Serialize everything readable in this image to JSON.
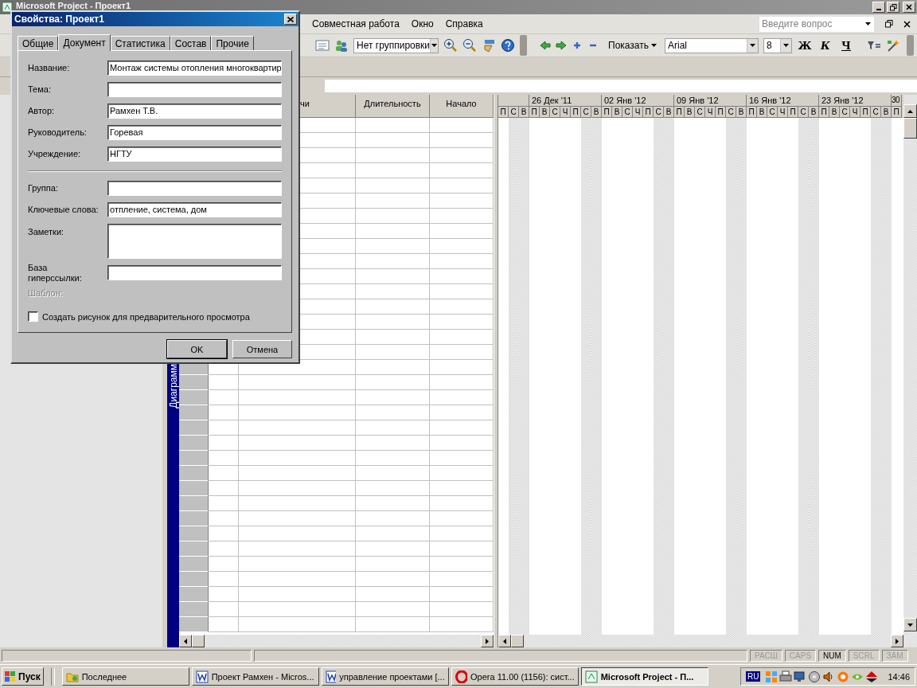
{
  "window": {
    "title": "Microsoft Project - Проект1"
  },
  "menu": [
    {
      "label": "Совместная работа"
    },
    {
      "label": "Окно"
    },
    {
      "label": "Справка"
    }
  ],
  "help_search": {
    "placeholder": "Введите вопрос"
  },
  "toolbar": {
    "grouping": "Нет группировки",
    "show": "Показать",
    "font": "Arial",
    "font_size": "8",
    "format_buttons": [
      {
        "label": "Ж",
        "kind": "bold"
      },
      {
        "label": "К",
        "kind": "italic"
      },
      {
        "label": "Ч",
        "kind": "underline"
      }
    ]
  },
  "side_label": "Диаграмм",
  "table": {
    "columns": [
      "чи",
      "Длительность",
      "Начало"
    ]
  },
  "gantt": {
    "weeks": [
      {
        "days": [
          {
            "label": "П",
            "weekend": false
          },
          {
            "label": "С",
            "weekend": true
          },
          {
            "label": "В",
            "weekend": true
          }
        ]
      },
      {
        "label": "26 Дек '11",
        "days": [
          {
            "label": "П",
            "weekend": false
          },
          {
            "label": "В",
            "weekend": false
          },
          {
            "label": "С",
            "weekend": false
          },
          {
            "label": "Ч",
            "weekend": false
          },
          {
            "label": "П",
            "weekend": false
          },
          {
            "label": "С",
            "weekend": true
          },
          {
            "label": "В",
            "weekend": true
          }
        ]
      },
      {
        "label": "02 Янв '12",
        "days": [
          {
            "label": "П",
            "weekend": false
          },
          {
            "label": "В",
            "weekend": false
          },
          {
            "label": "С",
            "weekend": false
          },
          {
            "label": "Ч",
            "weekend": false
          },
          {
            "label": "П",
            "weekend": false
          },
          {
            "label": "С",
            "weekend": true
          },
          {
            "label": "В",
            "weekend": true
          }
        ]
      },
      {
        "label": "09 Янв '12",
        "days": [
          {
            "label": "П",
            "weekend": false
          },
          {
            "label": "В",
            "weekend": false
          },
          {
            "label": "С",
            "weekend": false
          },
          {
            "label": "Ч",
            "weekend": false
          },
          {
            "label": "П",
            "weekend": false
          },
          {
            "label": "С",
            "weekend": true
          },
          {
            "label": "В",
            "weekend": true
          }
        ]
      },
      {
        "label": "16 Янв '12",
        "days": [
          {
            "label": "П",
            "weekend": false
          },
          {
            "label": "В",
            "weekend": false
          },
          {
            "label": "С",
            "weekend": false
          },
          {
            "label": "Ч",
            "weekend": false
          },
          {
            "label": "П",
            "weekend": false
          },
          {
            "label": "С",
            "weekend": true
          },
          {
            "label": "В",
            "weekend": true
          }
        ]
      },
      {
        "label": "23 Янв '12",
        "days": [
          {
            "label": "П",
            "weekend": false
          },
          {
            "label": "В",
            "weekend": false
          },
          {
            "label": "С",
            "weekend": false
          },
          {
            "label": "Ч",
            "weekend": false
          },
          {
            "label": "П",
            "weekend": false
          },
          {
            "label": "С",
            "weekend": true
          },
          {
            "label": "В",
            "weekend": true
          }
        ]
      },
      {
        "label": "30",
        "days": [
          {
            "label": "П",
            "weekend": false
          }
        ]
      }
    ]
  },
  "status_bar": {
    "indicators": [
      {
        "label": "РАСШ",
        "on": false
      },
      {
        "label": "CAPS",
        "on": false
      },
      {
        "label": "NUM",
        "on": true
      },
      {
        "label": "SCRL",
        "on": false
      },
      {
        "label": "ЗАМ",
        "on": false
      }
    ]
  },
  "taskbar": {
    "start": "Пуск",
    "tasks": [
      {
        "label": "Последнее",
        "kind": "folder",
        "selected": false
      },
      {
        "label": "Проект Рамхен - Micros...",
        "kind": "word",
        "selected": false
      },
      {
        "label": "управление проектами [...",
        "kind": "word",
        "selected": false
      },
      {
        "label": "Opera 11.00 (1156): сист...",
        "kind": "opera",
        "selected": false
      },
      {
        "label": "Microsoft Project - П...",
        "kind": "project",
        "selected": true
      }
    ],
    "language": "RU",
    "clock": "14:46"
  },
  "dialog": {
    "title": "Свойства: Проект1",
    "tabs": [
      {
        "label": "Общие",
        "selected": false
      },
      {
        "label": "Документ",
        "selected": true
      },
      {
        "label": "Статистика",
        "selected": false
      },
      {
        "label": "Состав",
        "selected": false
      },
      {
        "label": "Прочие",
        "selected": false
      }
    ],
    "fields": [
      {
        "label": "Название:",
        "value": "Монтаж системы отопления многоквартир",
        "kind": "line"
      },
      {
        "label": "Тема:",
        "kind": "line"
      },
      {
        "label": "Автор:",
        "value": "Рамхен Т.В.",
        "kind": "line"
      },
      {
        "label": "Руководитель:",
        "value": "Горевая",
        "kind": "line"
      },
      {
        "label": "Учреждение:",
        "value": "НГТУ",
        "kind": "line"
      },
      {
        "kind": "separator"
      },
      {
        "label": "Группа:",
        "kind": "line"
      },
      {
        "label": "Ключевые слова:",
        "value": "отпление, система, дом",
        "kind": "line"
      },
      {
        "label": "Заметки:",
        "kind": "multiline"
      },
      {
        "label": "База гиперссылки:",
        "kind": "line"
      }
    ],
    "template_label": {
      "label": "Шаблон:",
      "disabled": true
    },
    "checkbox": {
      "label": "Создать рисунок для предварительного просмотра",
      "checked": false
    },
    "buttons": [
      {
        "label": "OK",
        "default": true
      },
      {
        "label": "Отмена",
        "default": false
      }
    ]
  }
}
